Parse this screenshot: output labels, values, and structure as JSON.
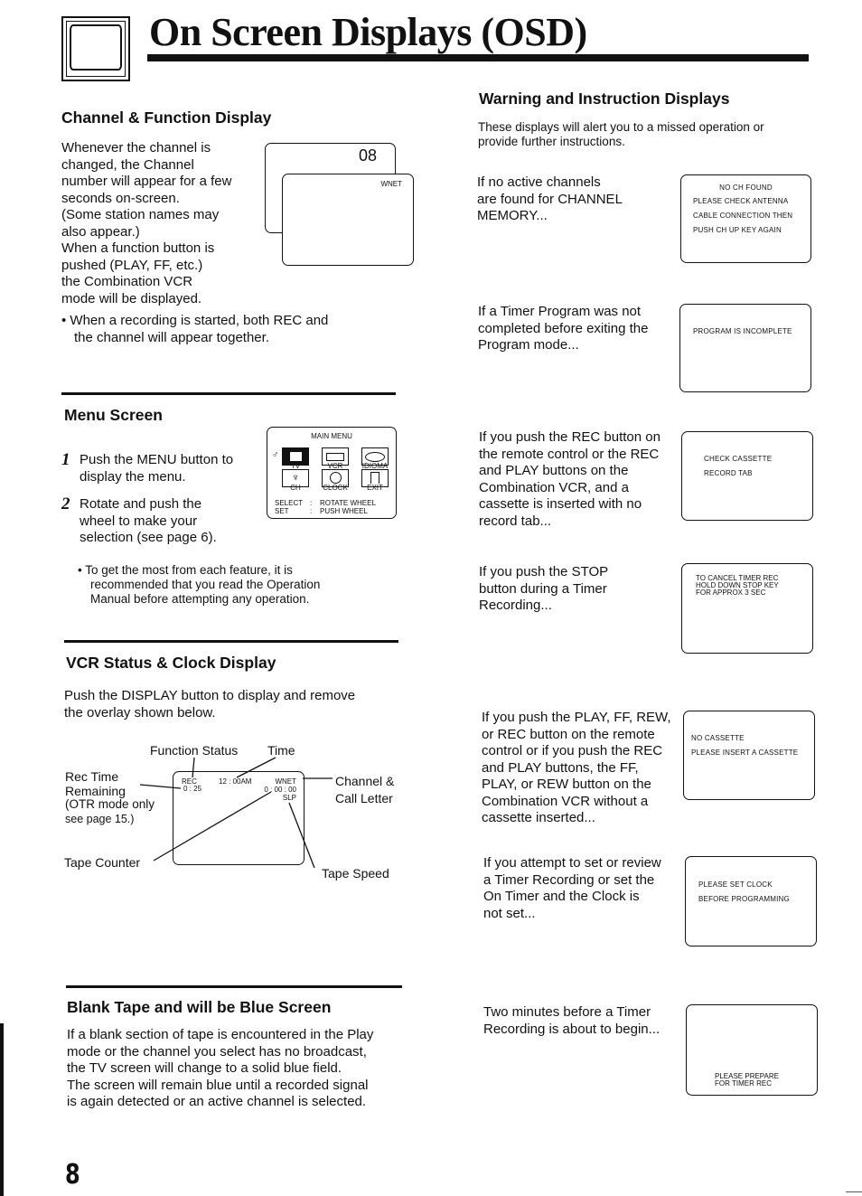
{
  "page": {
    "title": "On Screen Displays (OSD)",
    "page_number": "8",
    "icon": "tv-icon"
  },
  "channel_function": {
    "heading": "Channel & Function Display",
    "para1": [
      "Whenever the channel is",
      "changed, the Channel",
      "number will appear for a few",
      "seconds on-screen.",
      "(Some station names may",
      "also appear.)"
    ],
    "para2": [
      "When a function button is",
      "pushed (PLAY, FF, etc.)",
      "the Combination VCR",
      "mode will be displayed."
    ],
    "bullet": [
      "When a recording is started, both REC and",
      "the channel will appear together."
    ],
    "screen_channel": "08",
    "screen_station": "WNET"
  },
  "menu_screen": {
    "heading": "Menu Screen",
    "steps": [
      {
        "num": "1",
        "lines": [
          "Push the MENU button to",
          "display the menu."
        ]
      },
      {
        "num": "2",
        "lines": [
          "Rotate and push the",
          "wheel to make your",
          "selection (see page 6)."
        ]
      }
    ],
    "note": [
      "To get the most from each feature,  it is",
      "recommended that you read the Operation",
      "Manual before attempting any operation."
    ],
    "osd": {
      "title": "MAIN MENU",
      "items": [
        "TV",
        "VCR",
        "IDIOMA",
        "CH",
        "CLOCK",
        "EXIT"
      ],
      "select_label": "SELECT",
      "select_value": "ROTATE  WHEEL",
      "set_label": "SET",
      "set_value": "PUSH  WHEEL"
    }
  },
  "vcr_status": {
    "heading": "VCR Status & Clock Display",
    "para": [
      "Push the DISPLAY button to display and remove",
      "the overlay shown below."
    ],
    "callouts": {
      "function_status": "Function Status",
      "time": "Time",
      "rec_time": [
        "Rec Time",
        "Remaining"
      ],
      "otr_note": [
        "(OTR mode only",
        "see page 15.)"
      ],
      "channel": [
        "Channel &",
        "Call Letter"
      ],
      "tape_counter": "Tape Counter",
      "tape_speed": "Tape Speed"
    },
    "osd": {
      "function": "REC",
      "remaining": "0 : 25",
      "time": "12 : 00AM",
      "station": "WNET",
      "counter": "0 : 00 : 00",
      "speed": "SLP"
    }
  },
  "blank_tape": {
    "heading": "Blank Tape and will be Blue Screen",
    "para": [
      "If a blank section of tape is encountered in the Play",
      "mode or the channel you select has no broadcast,",
      "the TV screen will change to a solid blue field.",
      "The screen will remain blue until a recorded signal",
      "is again detected or an active channel is selected."
    ]
  },
  "warnings": {
    "heading": "Warning and Instruction Displays",
    "intro": [
      "These displays will alert you to a missed operation or",
      "provide further instructions."
    ],
    "items": [
      {
        "text": [
          "If no active channels",
          "are found for CHANNEL",
          "MEMORY..."
        ],
        "osd": [
          "NO CH FOUND",
          "PLEASE CHECK ANTENNA",
          "CABLE CONNECTION THEN",
          "PUSH CH UP KEY AGAIN"
        ]
      },
      {
        "text": [
          "If a Timer Program was not",
          "completed before exiting the",
          "Program mode..."
        ],
        "osd": [
          "PROGRAM IS INCOMPLETE"
        ]
      },
      {
        "text": [
          "If you push the REC button on",
          "the remote control or the REC",
          "and PLAY buttons on the",
          "Combination VCR, and a",
          "cassette is inserted with no",
          "record tab..."
        ],
        "osd": [
          "CHECK CASSETTE",
          "RECORD TAB"
        ]
      },
      {
        "text": [
          "If you push the STOP",
          "button during a Timer",
          "Recording..."
        ],
        "osd": [
          "TO CANCEL TIMER REC",
          "HOLD DOWN STOP KEY",
          "FOR APPROX 3 SEC"
        ]
      },
      {
        "text": [
          "If you push the PLAY, FF, REW,",
          "or REC button on the remote",
          "control or if you push the REC",
          "and PLAY buttons, the FF,",
          "PLAY, or REW button on the",
          "Combination VCR without a",
          "cassette inserted..."
        ],
        "osd": [
          "NO CASSETTE",
          "PLEASE INSERT A CASSETTE"
        ]
      },
      {
        "text": [
          "If you attempt to set or review",
          "a Timer Recording or set the",
          "On Timer and the Clock is",
          "not set..."
        ],
        "osd": [
          "PLEASE SET CLOCK",
          "BEFORE PROGRAMMING"
        ]
      },
      {
        "text": [
          "Two minutes before a Timer",
          "Recording is about to begin..."
        ],
        "osd": [
          "PLEASE PREPARE",
          "FOR TIMER REC"
        ]
      }
    ]
  }
}
